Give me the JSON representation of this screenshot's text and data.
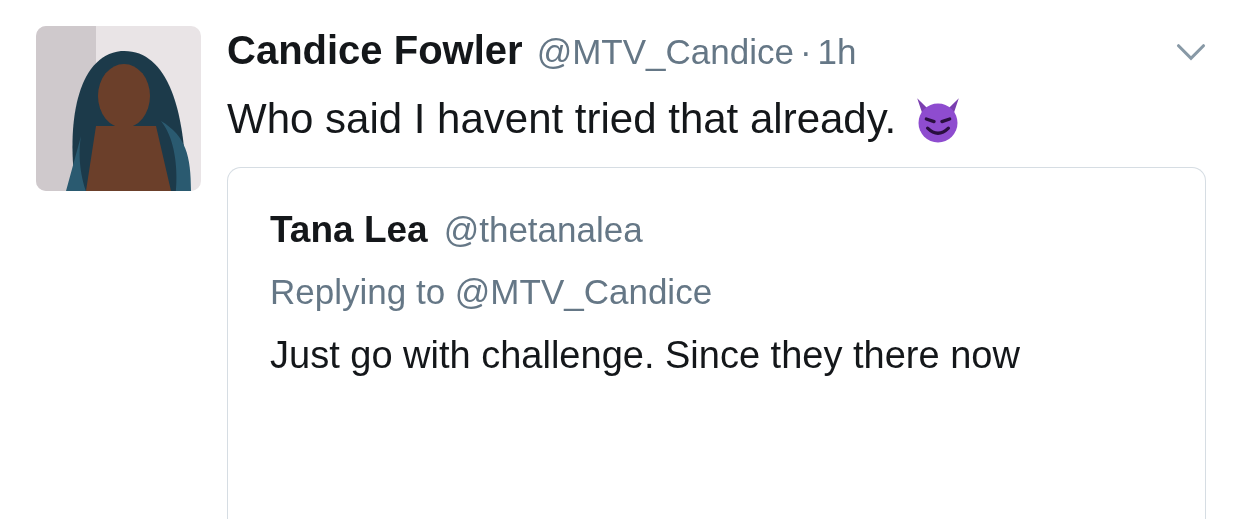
{
  "tweet": {
    "author": {
      "name": "Candice Fowler",
      "handle": "@MTV_Candice",
      "separator": "·",
      "time": "1h"
    },
    "text": "Who said I havent tried that already.",
    "quoted": {
      "name": "Tana Lea",
      "handle": "@thetanalea",
      "replying_to": "Replying to @MTV_Candice",
      "text": "Just go with challenge. Since they there now"
    }
  }
}
